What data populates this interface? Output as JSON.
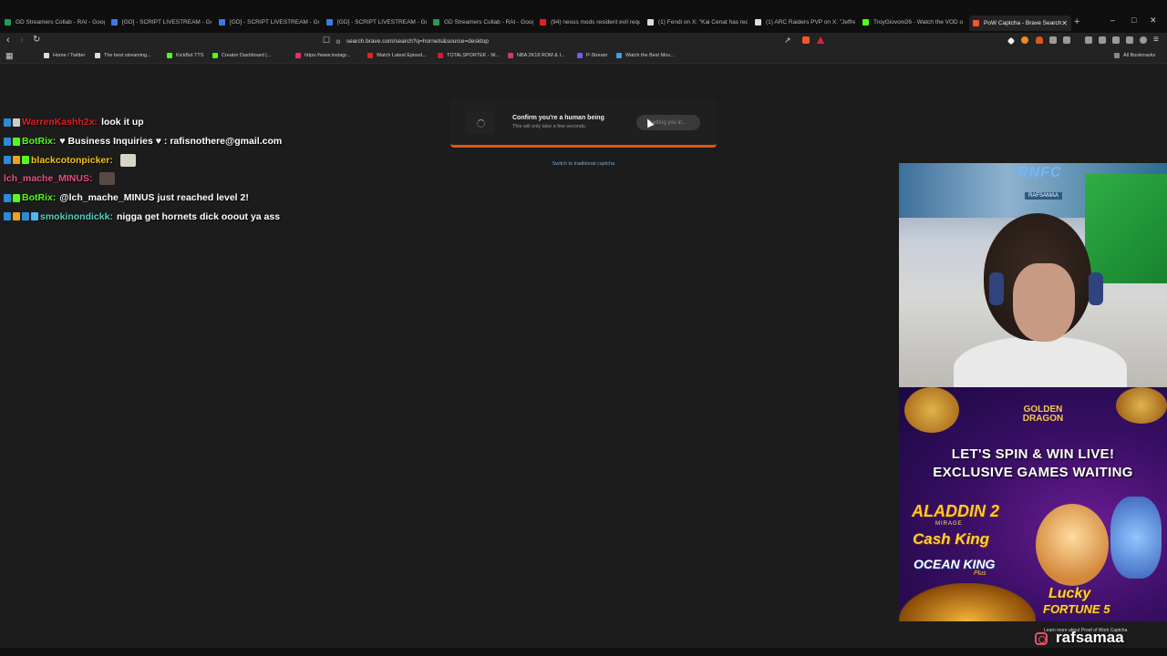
{
  "browser": {
    "tabs": [
      {
        "title": "GD Streamers Collab - RAI - Googl",
        "icon": "sheets-icon",
        "color": "#1e9e52"
      },
      {
        "title": "[GD] - SCRIPT LIVESTREAM - Goog",
        "icon": "docs-icon",
        "color": "#3b7be8"
      },
      {
        "title": "[GD] - SCRIPT LIVESTREAM - Goog",
        "icon": "docs-icon",
        "color": "#3b7be8"
      },
      {
        "title": "[GD] - SCRIPT LIVESTREAM - Goog",
        "icon": "docs-icon",
        "color": "#3b7be8"
      },
      {
        "title": "GD Streamers Collab - RAI - Googl",
        "icon": "sheets-icon",
        "color": "#1e9e52"
      },
      {
        "title": "(94) nexus mods resident evil requ",
        "icon": "youtube-icon",
        "color": "#e22222"
      },
      {
        "title": "(1) Fendi on X: \"Kai Cenat has req",
        "icon": "x-icon",
        "color": "#dddddd"
      },
      {
        "title": "(1) ARC Raiders PVP on X: \"Jeffrey",
        "icon": "x-icon",
        "color": "#dddddd"
      },
      {
        "title": "TroyGiovoni26 - Watch the VOD on",
        "icon": "kick-icon",
        "color": "#53fc18"
      },
      {
        "title": "PoW Captcha - Brave Search",
        "icon": "brave-icon",
        "color": "#fb542b"
      }
    ],
    "url": "search.brave.com/search?q=hornets&source=desktop",
    "bookmarks": [
      {
        "label": "Home / Twitter",
        "color": "#dddddd"
      },
      {
        "label": "The best streaming...",
        "color": "#dddddd"
      },
      {
        "label": "KickBot TTS",
        "color": "#53fc18"
      },
      {
        "label": "Creator Dashboard |...",
        "color": "#53fc18"
      },
      {
        "label": "https://www.instagr...",
        "color": "#e1306c"
      },
      {
        "label": "Watch Latest Episod...",
        "color": "#e22222"
      },
      {
        "label": "TOTALSPORTEK - W...",
        "color": "#d21a3a"
      },
      {
        "label": "NBA 2K18 ROM & I...",
        "color": "#d2386f"
      },
      {
        "label": "P-Stream",
        "color": "#6d5cff"
      },
      {
        "label": "Watch the Best Mov...",
        "color": "#3aa0e8"
      }
    ],
    "all_bookmarks": "All Bookmarks"
  },
  "captcha": {
    "title": "Confirm you're a human being",
    "subtitle": "This will only take a few seconds.",
    "button": "Letting you in...",
    "switch_link": "Switch to traditional captcha",
    "accent": "#e0561c"
  },
  "chat": [
    {
      "user": "WarrenKashh2x:",
      "user_color": "#e11d2a",
      "text": "look it up",
      "badges": [
        "#2b8bd8",
        "#cccccc"
      ]
    },
    {
      "user": "BotRix:",
      "user_color": "#53fc18",
      "text": "♥ Business Inquiries ♥ : rafisnothere@gmail.com",
      "badges": [
        "#2b8bd8",
        "#53fc18"
      ]
    },
    {
      "user": "blackcotonpicker:",
      "user_color": "#f5c518",
      "text": "",
      "badges": [
        "#2b8bd8",
        "#f0a020",
        "#53fc18"
      ],
      "emote": true
    },
    {
      "user": "lch_mache_MINUS:",
      "user_color": "#e94d8a",
      "text": "",
      "badges": [],
      "emote": true
    },
    {
      "user": "BotRix:",
      "user_color": "#53fc18",
      "text": "@lch_mache_MINUS just reached level 2!",
      "badges": [
        "#2b8bd8",
        "#53fc18"
      ]
    },
    {
      "user": "smokinondickk:",
      "user_color": "#4fd1c5",
      "text": "nigga get hornets dick ooout ya ass",
      "badges": [
        "#2b8bd8",
        "#f0a020",
        "#2b8bd8",
        "#4fb6f0"
      ]
    }
  ],
  "webcam": {
    "logo": "RNFC",
    "banner": "RAFSAMAA"
  },
  "ad": {
    "brand": "GOLDEN DRAGON",
    "headline1": "LET'S SPIN & WIN LIVE!",
    "headline2": "EXCLUSIVE GAMES WAITING",
    "game1": "ALADDIN 2",
    "game1_sub": "MIRAGE",
    "game2": "Cash King",
    "game3": "OCEAN KING",
    "game3_sub": "Plus",
    "game4": "Lucky",
    "game4_sub": "FORTUNE 5"
  },
  "overlay": {
    "pow_note": "Learn more about Proof of Work Captcha",
    "handle": "rafsamaa"
  }
}
